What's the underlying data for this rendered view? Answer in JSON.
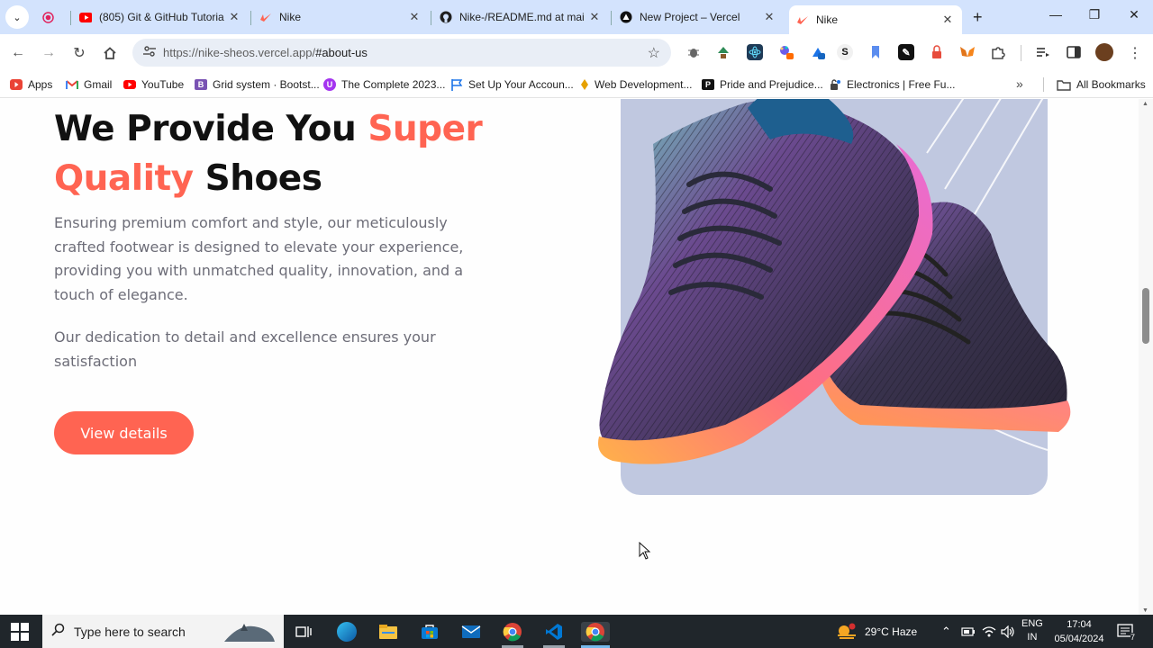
{
  "browser": {
    "tabs": [
      {
        "title": "",
        "icon": "record-icon"
      },
      {
        "title": "(805) Git & GitHub Tutoria",
        "icon": "youtube-icon"
      },
      {
        "title": "Nike",
        "icon": "nike-icon"
      },
      {
        "title": "Nike-/README.md at mai",
        "icon": "github-icon"
      },
      {
        "title": "New Project – Vercel",
        "icon": "vercel-icon"
      },
      {
        "title": "Nike",
        "icon": "nike-icon",
        "active": true
      }
    ],
    "url_host": "https://nike-sheos.vercel.app/",
    "url_path": "#about-us",
    "bookmarks": [
      {
        "label": "Apps",
        "icon": "apps-icon",
        "color": "#ea4335"
      },
      {
        "label": "Gmail",
        "icon": "gmail-icon",
        "color": "#ea4335"
      },
      {
        "label": "YouTube",
        "icon": "youtube-icon",
        "color": "#ff0000"
      },
      {
        "label": "Grid system · Bootst...",
        "icon": "bootstrap-icon",
        "color": "#7952b3"
      },
      {
        "label": "The Complete 2023...",
        "icon": "udemy-icon",
        "color": "#a435f0"
      },
      {
        "label": "Set Up Your Accoun...",
        "icon": "flag-icon",
        "color": "#1a73e8"
      },
      {
        "label": "Web Development...",
        "icon": "web-dev-icon",
        "color": "#e6a100"
      },
      {
        "label": "Pride and Prejudice...",
        "icon": "p-icon",
        "color": "#111111"
      },
      {
        "label": "Electronics | Free Fu...",
        "icon": "lock-icon",
        "color": "#444444"
      }
    ],
    "all_bookmarks": "All Bookmarks"
  },
  "page": {
    "heading_part1": "We Provide You ",
    "heading_accent1": "Super",
    "heading_accent2": "Quality",
    "heading_part2": " Shoes",
    "paragraph1": "Ensuring premium comfort and style, our meticulously crafted footwear is designed to elevate your experience, providing you with unmatched quality, innovation, and a touch of elegance.",
    "paragraph2": "Our dedication to detail and excellence ensures your satisfaction",
    "cta_label": "View details",
    "accent_color": "#ff6452",
    "image_alt": "shoe-image"
  },
  "taskbar": {
    "search_placeholder": "Type here to search",
    "weather": "29°C  Haze",
    "lang_top": "ENG",
    "lang_bottom": "IN",
    "time": "17:04",
    "date": "05/04/2024",
    "notifications": "7"
  }
}
